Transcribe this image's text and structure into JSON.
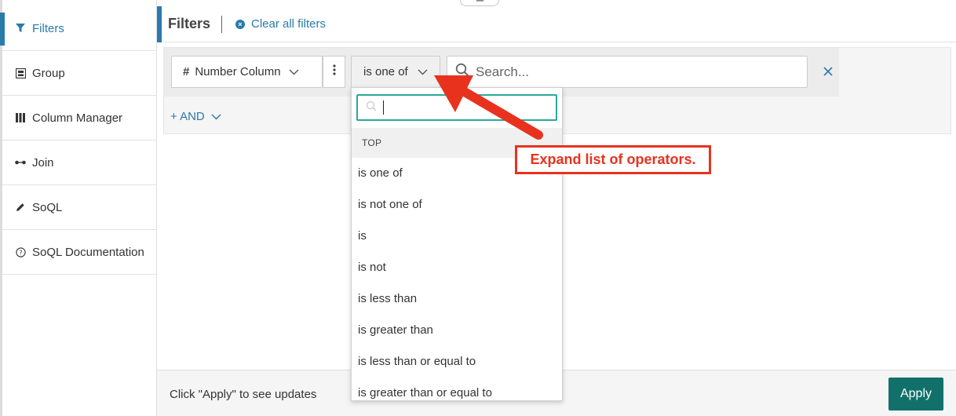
{
  "sidebar": {
    "items": [
      {
        "label": "Filters",
        "icon": "funnel-icon",
        "active": true
      },
      {
        "label": "Group",
        "icon": "group-icon"
      },
      {
        "label": "Column Manager",
        "icon": "columns-icon"
      },
      {
        "label": "Join",
        "icon": "join-icon"
      },
      {
        "label": "SoQL",
        "icon": "pencil-icon"
      },
      {
        "label": "SoQL Documentation",
        "icon": "help-circle-icon"
      }
    ]
  },
  "header": {
    "title": "Filters",
    "clear_label": "Clear all filters"
  },
  "filter": {
    "column_hash": "#",
    "column_label": "Number Column",
    "operator_label": "is one of",
    "search_placeholder": "Search...",
    "and_label": "+ AND"
  },
  "dropdown": {
    "section_label": "TOP",
    "options": [
      "is one of",
      "is not one of",
      "is",
      "is not",
      "is less than",
      "is greater than",
      "is less than or equal to",
      "is greater than or equal to"
    ]
  },
  "annotation": {
    "text": "Expand list of operators.",
    "color": "#e8321e"
  },
  "footer": {
    "note": "Click \"Apply\" to see updates",
    "apply_label": "Apply"
  },
  "colors": {
    "accent": "#2a7aab",
    "apply": "#12706b",
    "focus": "#2aa89a"
  }
}
